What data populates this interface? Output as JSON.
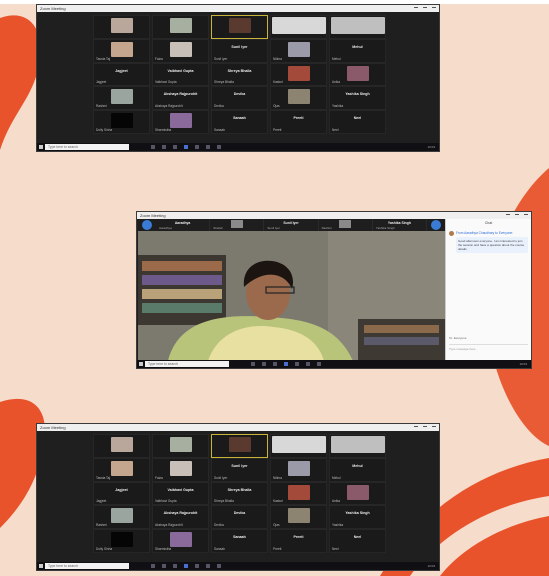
{
  "app": {
    "window_title": "Zoom Meeting",
    "search_placeholder": "Type here to search",
    "tray_time": "10:03"
  },
  "gallery": {
    "rows": [
      [
        {
          "name": "",
          "thumb": "face",
          "tone": "#b8a79a"
        },
        {
          "name": "",
          "thumb": "face",
          "tone": "#a7b0a0"
        },
        {
          "name": "",
          "thumb": "face",
          "tone": "#5a3a2e",
          "active": true
        },
        {
          "name": "",
          "thumb": "wide",
          "tone": "#d8d8d8"
        },
        {
          "name": "",
          "thumb": "wide",
          "tone": "#bfbfbf"
        }
      ],
      [
        {
          "name": "Tasnia Taj",
          "thumb": "face",
          "tone": "#c4a58d"
        },
        {
          "name": "Faiza",
          "thumb": "face",
          "tone": "#c8c0b8"
        },
        {
          "name": "Sunil Iyer",
          "center": "Sunil Iyer"
        },
        {
          "name": "Nilima",
          "thumb": "face",
          "tone": "#9a9aa8"
        },
        {
          "name": "Mehul",
          "center": "Mehul"
        }
      ],
      [
        {
          "name": "Jagjeet",
          "center": "Jagjeet"
        },
        {
          "name": "Vaibhavi Gupta",
          "center": "Vaibhavi Gupta"
        },
        {
          "name": "Shreya Bhalla",
          "center": "Shreya Bhalla"
        },
        {
          "name": "Kasturi",
          "thumb": "face",
          "tone": "#a44a3a"
        },
        {
          "name": "Anika",
          "thumb": "face",
          "tone": "#8a5a6a"
        }
      ],
      [
        {
          "name": "Rashmi",
          "thumb": "face",
          "tone": "#9aa5a0"
        },
        {
          "name": "Akshaya Rajpurohit",
          "center": "Akshaya Rajpurohit"
        },
        {
          "name": "Devika",
          "center": "Devika"
        },
        {
          "name": "Ojas",
          "thumb": "face",
          "tone": "#8c8470"
        },
        {
          "name": "Yashika",
          "center": "Yashika Singh"
        }
      ],
      [
        {
          "name": "Dolly Sinha",
          "thumb": "dark",
          "tone": "#050505"
        },
        {
          "name": "Sharmistha",
          "thumb": "face",
          "tone": "#8a6a9a"
        },
        {
          "name": "Sanaah",
          "center": "Sanaah"
        },
        {
          "name": "Preeti",
          "center": "Preeti"
        },
        {
          "name": "Neel",
          "center": "Neel"
        }
      ]
    ]
  },
  "speaker_view": {
    "strip": [
      {
        "name": "Aaradhya",
        "center": "Aaradhya"
      },
      {
        "name": "Shefali",
        "thumb": true
      },
      {
        "name": "Sunil Iyer",
        "center": "Sunil Iyer"
      },
      {
        "name": "Rashmi",
        "thumb": true
      },
      {
        "name": "Yashika Singh",
        "center": "Yashika Singh"
      }
    ],
    "chat": {
      "title": "Chat",
      "from": "From Aaradhya Chaudhary to Everyone:",
      "message": "Good afternoon everyone. I am interested to join the session and have a question about the course details.",
      "to": "To: Everyone",
      "input_placeholder": "Type message here..."
    }
  }
}
